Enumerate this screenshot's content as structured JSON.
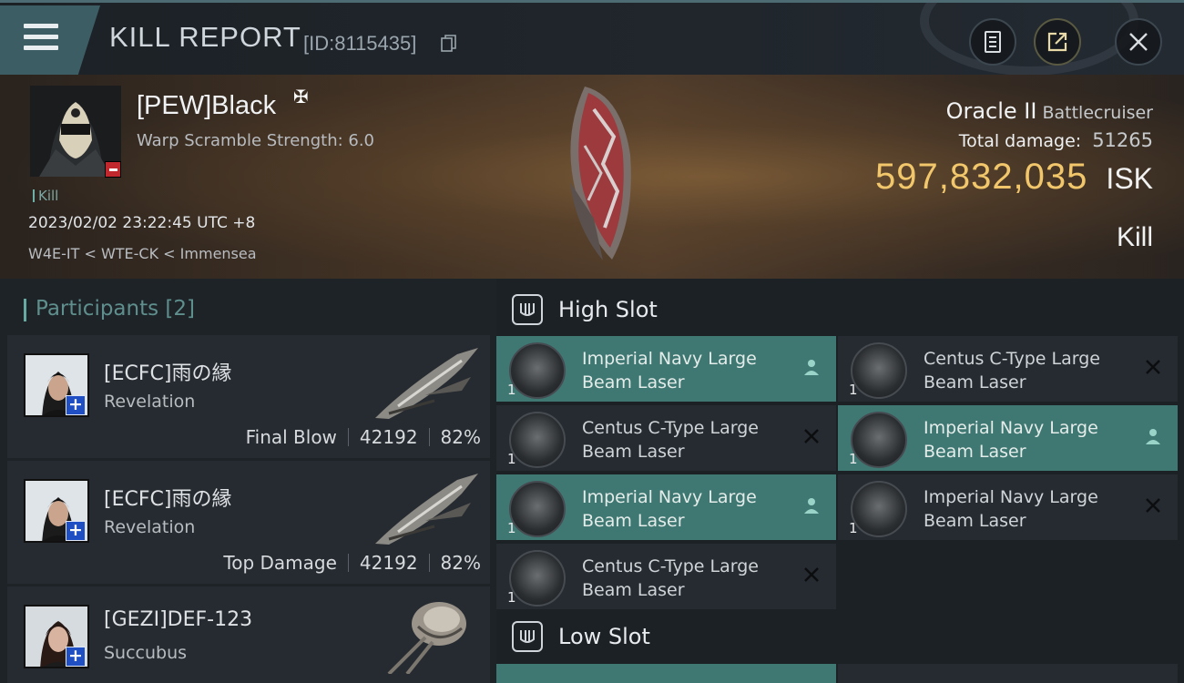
{
  "header": {
    "title": "KILL REPORT",
    "report_id": "[ID:8115435]",
    "buttons": {
      "report": "clipboard-icon",
      "share": "share-icon",
      "close": "close-icon"
    }
  },
  "victim": {
    "name": "[PEW]Black",
    "warp_scramble": "Warp Scramble Strength: 6.0",
    "kill_tag": "Kill",
    "datetime": "2023/02/02 23:22:45 UTC +8",
    "location": "W4E-IT < WTE-CK < Immensea",
    "ship": "Oracle II",
    "ship_class": "Battlecruiser",
    "total_damage_label": "Total damage:",
    "total_damage": "51265",
    "isk_value": "597,832,035",
    "isk_unit": "ISK",
    "result": "Kill"
  },
  "participants": {
    "title": "Participants",
    "count": "[2]",
    "items": [
      {
        "name": "[ECFC]雨の縁",
        "ship": "Revelation",
        "role": "Final Blow",
        "damage": "42192",
        "percent": "82%"
      },
      {
        "name": "[ECFC]雨の縁",
        "ship": "Revelation",
        "role": "Top Damage",
        "damage": "42192",
        "percent": "82%"
      },
      {
        "name": "[GEZI]DEF-123",
        "ship": "Succubus"
      }
    ]
  },
  "fitting": {
    "high_slot": {
      "label": "High Slot",
      "modules": [
        {
          "name": "Imperial Navy Large Beam Laser",
          "qty": "1",
          "status": "fitted-icon",
          "active": true
        },
        {
          "name": "Centus C-Type Large Beam Laser",
          "qty": "1",
          "status": "destroyed-icon",
          "active": false
        },
        {
          "name": "Centus C-Type Large Beam Laser",
          "qty": "1",
          "status": "destroyed-icon",
          "active": false
        },
        {
          "name": "Imperial Navy Large Beam Laser",
          "qty": "1",
          "status": "fitted-icon",
          "active": true
        },
        {
          "name": "Imperial Navy Large Beam Laser",
          "qty": "1",
          "status": "fitted-icon",
          "active": true
        },
        {
          "name": "Imperial Navy Large Beam Laser",
          "qty": "1",
          "status": "destroyed-icon",
          "active": false
        },
        {
          "name": "Centus C-Type Large Beam Laser",
          "qty": "1",
          "status": "destroyed-icon",
          "active": false
        }
      ]
    },
    "low_slot": {
      "label": "Low Slot"
    }
  },
  "colors": {
    "accent": "#3f7872",
    "isk": "#f2c76b",
    "minus_badge": "#c0282e",
    "plus_badge": "#1f4fc2"
  }
}
